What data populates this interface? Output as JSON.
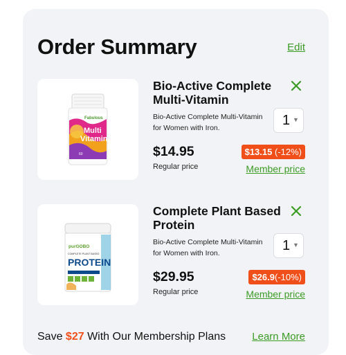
{
  "header": {
    "title": "Order Summary",
    "edit_label": "Edit"
  },
  "items": [
    {
      "name": "Bio-Active Complete Multi-Vitamin",
      "description": "Bio-Active Complete Multi-Vitamin for Women with Iron.",
      "quantity": "1",
      "price": "$14.95",
      "regular_label": "Regular price",
      "member_price": "$13.15",
      "member_discount": "(-12%)",
      "member_label": "Member price",
      "image": {
        "icon": "vitamin-bottle-icon",
        "brand": "Fabulous",
        "line1": "Multi",
        "line2": "Vitamin",
        "count": "60"
      }
    },
    {
      "name": "Complete Plant Based Protein",
      "description": "Bio-Active Complete Multi-Vitamin for Women with Iron.",
      "quantity": "1",
      "price": "$29.95",
      "regular_label": "Regular price",
      "member_price": "$26.9",
      "member_discount": "(-10%)",
      "member_label": "Member price",
      "image": {
        "icon": "protein-tub-icon",
        "brand": "purGOBO",
        "line1": "COMPLETE PLANT BASED",
        "line2": "PROTEIN"
      }
    }
  ],
  "footer": {
    "save_prefix": "Save ",
    "save_amount": "$27",
    "save_suffix": " With Our Membership Plans",
    "learn_more_label": "Learn More"
  },
  "colors": {
    "panel": "#f2f3f6",
    "accent_green": "#3a9b25",
    "discount_orange": "#f04f1a"
  }
}
